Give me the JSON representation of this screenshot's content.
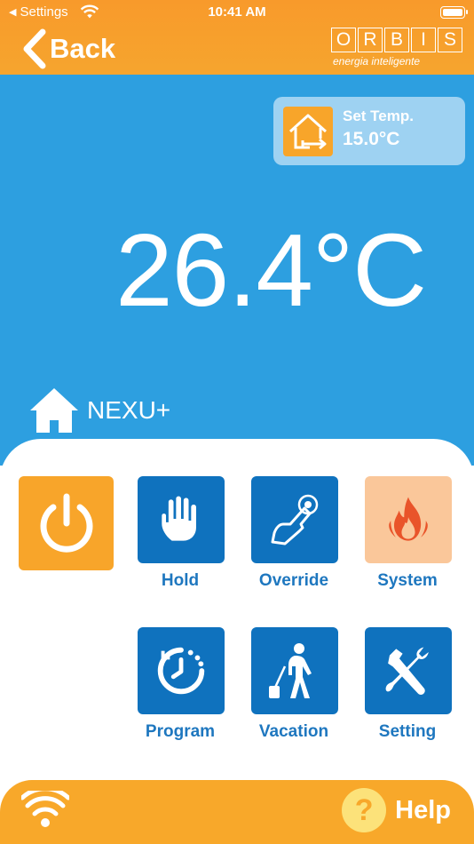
{
  "status_bar": {
    "back_label": "Settings",
    "time": "10:41 AM"
  },
  "nav": {
    "back_label": "Back",
    "logo_letters": [
      "O",
      "R",
      "B",
      "I",
      "S"
    ],
    "logo_tagline": "energia inteligente"
  },
  "set_temp": {
    "label": "Set Temp.",
    "value": "15.0°C"
  },
  "current_temperature": "26.4°C",
  "device": {
    "name": "NEXU+"
  },
  "tiles": [
    {
      "label": "",
      "icon": "power-icon",
      "color": "#F8A52A"
    },
    {
      "label": "Hold",
      "icon": "hand-icon",
      "color": "#0F72BE"
    },
    {
      "label": "Override",
      "icon": "touch-finger-icon",
      "color": "#0F72BE"
    },
    {
      "label": "System",
      "icon": "flame-icon",
      "color": "#FAC79A"
    },
    {
      "label": "Program",
      "icon": "clock-icon",
      "color": "#0F72BE"
    },
    {
      "label": "Vacation",
      "icon": "traveler-icon",
      "color": "#0F72BE"
    },
    {
      "label": "Setting",
      "icon": "tools-icon",
      "color": "#0F72BE"
    }
  ],
  "footer": {
    "help_label": "Help"
  },
  "colors": {
    "header_orange": "#F89A2B",
    "panel_blue": "#2D9FE0",
    "tile_blue": "#0F72BE",
    "label_blue": "#1E77BF",
    "footer_orange": "#F8A82A"
  }
}
